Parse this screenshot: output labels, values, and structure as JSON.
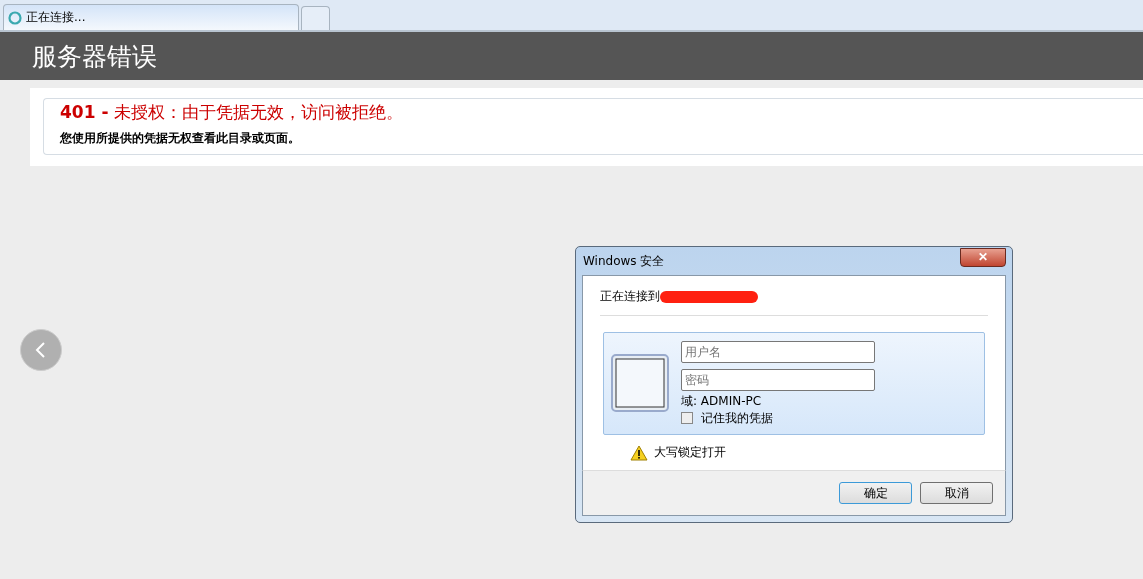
{
  "browser_tabs": [
    {
      "title": "正在连接...",
      "selected": true
    },
    {
      "selected": false
    }
  ],
  "header": {
    "title": "服务器错误"
  },
  "error": {
    "code": "401 -",
    "heading": "未授权：由于凭据无效，访问被拒绝。",
    "message": "您使用所提供的凭据无权查看此目录或页面。"
  },
  "dialog": {
    "title": "Windows 安全",
    "close": "✕",
    "connecting": "正在连接到",
    "username": {
      "placeholder": "用户名"
    },
    "password": {
      "placeholder": "密码"
    },
    "domain": "域: ADMIN-PC",
    "remember": {
      "label": "记住我的凭据",
      "checked": false
    },
    "warning": "大写锁定打开",
    "buttons": [
      {
        "label": "确定",
        "selected": true
      },
      {
        "label": "取消",
        "selected": false
      }
    ]
  }
}
